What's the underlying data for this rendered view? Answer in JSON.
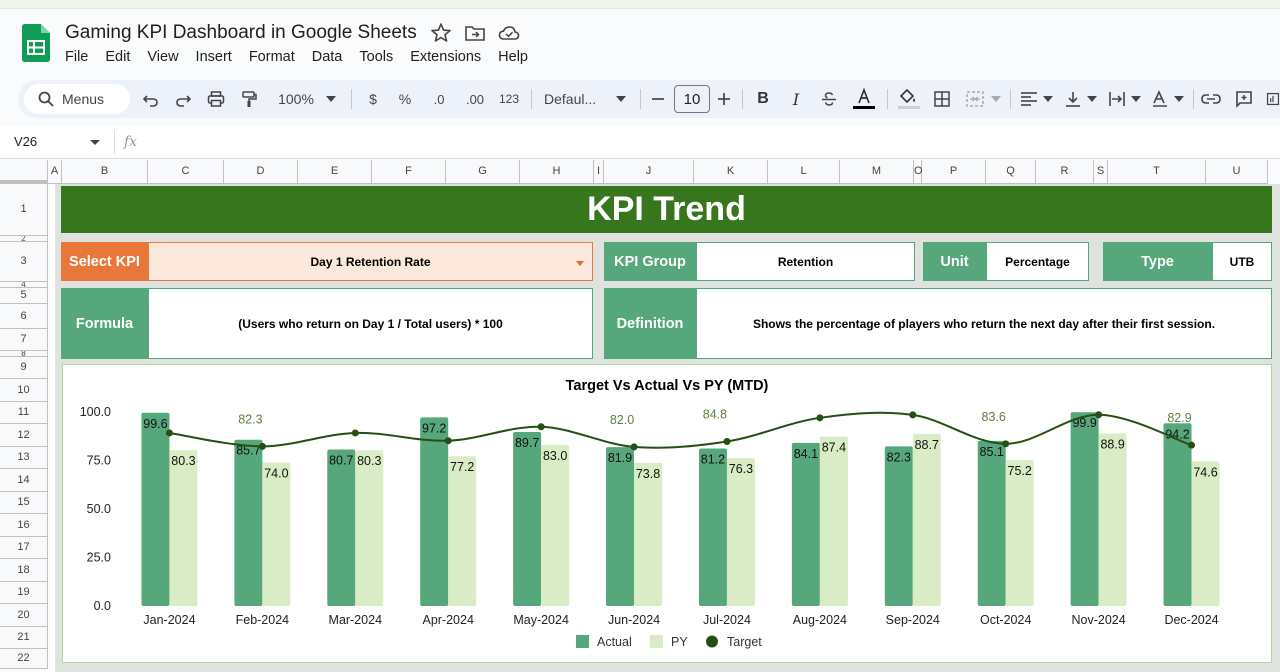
{
  "app": {
    "doc_title": "Gaming KPI Dashboard in Google Sheets",
    "menus": [
      "File",
      "Edit",
      "View",
      "Insert",
      "Format",
      "Data",
      "Tools",
      "Extensions",
      "Help"
    ]
  },
  "toolbar": {
    "search_label": "Menus",
    "zoom": "100%",
    "currency": "$",
    "percent": "%",
    "dec_decrease": ".0",
    "dec_increase": ".00",
    "number_format": "123",
    "font": "Defaul...",
    "font_size": "10"
  },
  "formula_bar": {
    "name_box": "V26",
    "fx": "fx",
    "content": ""
  },
  "columns": [
    {
      "id": "A",
      "w": 14
    },
    {
      "id": "B",
      "w": 86
    },
    {
      "id": "C",
      "w": 76
    },
    {
      "id": "D",
      "w": 74
    },
    {
      "id": "E",
      "w": 74
    },
    {
      "id": "F",
      "w": 74
    },
    {
      "id": "G",
      "w": 74
    },
    {
      "id": "H",
      "w": 74
    },
    {
      "id": "I",
      "w": 10
    },
    {
      "id": "J",
      "w": 90
    },
    {
      "id": "K",
      "w": 74
    },
    {
      "id": "L",
      "w": 72
    },
    {
      "id": "M",
      "w": 74
    },
    {
      "id": "O",
      "w": 8
    },
    {
      "id": "P",
      "w": 64
    },
    {
      "id": "Q",
      "w": 50
    },
    {
      "id": "R",
      "w": 58
    },
    {
      "id": "S",
      "w": 14
    },
    {
      "id": "T",
      "w": 98
    },
    {
      "id": "U",
      "w": 62
    }
  ],
  "rows": [
    {
      "id": "1",
      "h": 52
    },
    {
      "id": "2",
      "h": 6
    },
    {
      "id": "3",
      "h": 40
    },
    {
      "id": "4",
      "h": 6
    },
    {
      "id": "5",
      "h": 16
    },
    {
      "id": "6",
      "h": 25
    },
    {
      "id": "7",
      "h": 22
    },
    {
      "id": "8",
      "h": 6
    },
    {
      "id": "9",
      "h": 22
    },
    {
      "id": "10",
      "h": 23
    },
    {
      "id": "11",
      "h": 22
    },
    {
      "id": "12",
      "h": 23
    },
    {
      "id": "13",
      "h": 22
    },
    {
      "id": "14",
      "h": 23
    },
    {
      "id": "15",
      "h": 22
    },
    {
      "id": "16",
      "h": 23
    },
    {
      "id": "17",
      "h": 22
    },
    {
      "id": "18",
      "h": 23
    },
    {
      "id": "19",
      "h": 22
    },
    {
      "id": "20",
      "h": 23
    },
    {
      "id": "21",
      "h": 22
    },
    {
      "id": "22",
      "h": 20
    }
  ],
  "dashboard": {
    "title": "KPI Trend",
    "select_kpi_label": "Select KPI",
    "select_kpi_value": "Day 1 Retention Rate",
    "kpi_group_label": "KPI Group",
    "kpi_group_value": "Retention",
    "unit_label": "Unit",
    "unit_value": "Percentage",
    "type_label": "Type",
    "type_value": "UTB",
    "formula_label": "Formula",
    "formula_value": "(Users who return on Day 1 / Total users) * 100",
    "definition_label": "Definition",
    "definition_value": "Shows the percentage of players who return the next day after their first session."
  },
  "colors": {
    "banner": "#38761d",
    "label_green": "#57a77d",
    "label_orange": "#e8773a",
    "select_fill": "#fce8dc",
    "actual": "#57a77d",
    "py": "#d9ecc5",
    "target": "#274e13"
  },
  "chart_data": {
    "type": "bar",
    "title": "Target Vs Actual Vs PY (MTD)",
    "categories": [
      "Jan-2024",
      "Feb-2024",
      "Mar-2024",
      "Apr-2024",
      "May-2024",
      "Jun-2024",
      "Jul-2024",
      "Aug-2024",
      "Sep-2024",
      "Oct-2024",
      "Nov-2024",
      "Dec-2024"
    ],
    "series": [
      {
        "name": "Actual",
        "type": "bar",
        "values": [
          99.6,
          85.7,
          80.7,
          97.2,
          89.7,
          81.9,
          81.2,
          84.1,
          82.3,
          85.1,
          99.9,
          94.2
        ]
      },
      {
        "name": "PY",
        "type": "bar",
        "values": [
          80.3,
          74.0,
          80.3,
          77.2,
          83.0,
          73.8,
          76.3,
          87.4,
          88.7,
          75.2,
          88.9,
          74.6
        ]
      },
      {
        "name": "Target",
        "type": "line",
        "values": [
          89.2,
          82.3,
          89.2,
          85.2,
          92.4,
          82.0,
          84.8,
          97.0,
          98.5,
          83.6,
          98.6,
          82.9
        ]
      }
    ],
    "data_labels": {
      "Actual": [
        "99.6",
        "85.7",
        "80.7",
        "97.2",
        "89.7",
        "81.9",
        "81.2",
        "84.1",
        "82.3",
        "85.1",
        "99.9",
        "94.2"
      ],
      "PY": [
        "80.3",
        "74.0",
        "80.3",
        "77.2",
        "83.0",
        "73.8",
        "76.3",
        "87.4",
        "88.7",
        "75.2",
        "88.9",
        "74.6"
      ],
      "Target": [
        "",
        "82.3",
        "",
        "",
        "",
        "82.0",
        "84.8",
        "",
        "",
        "83.6",
        "",
        "82.9"
      ]
    },
    "yticks": [
      "0.0",
      "25.0",
      "50.0",
      "75.0",
      "100.0"
    ],
    "ylim": [
      0,
      100
    ],
    "legend": "bottom",
    "smooth_line": true
  }
}
